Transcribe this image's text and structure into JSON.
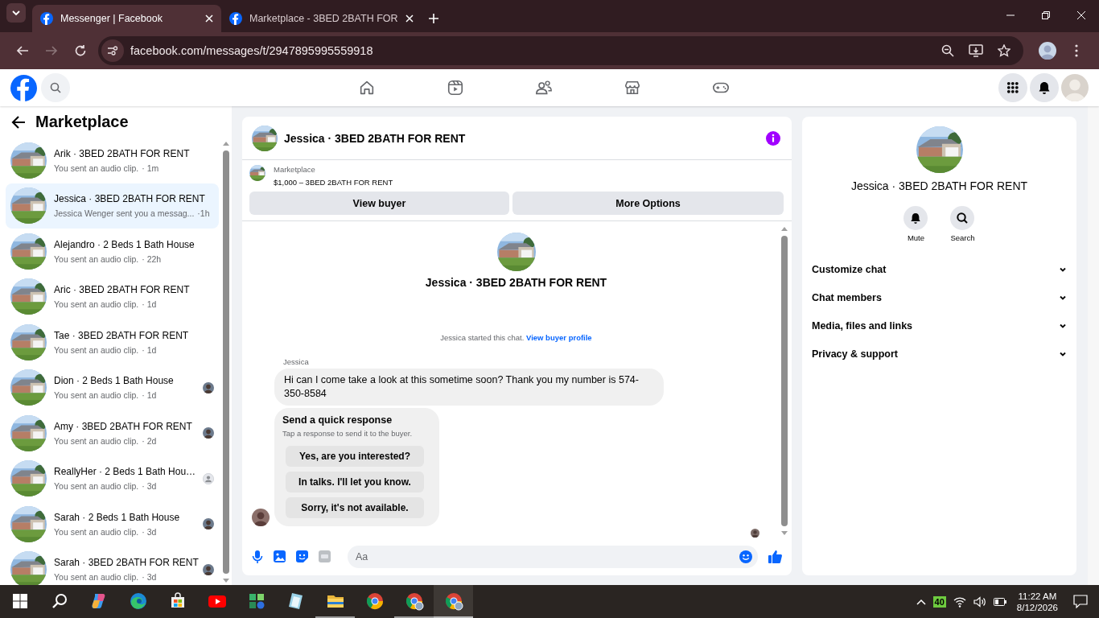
{
  "browser": {
    "tabs": [
      {
        "title": "Messenger | Facebook",
        "selected": true
      },
      {
        "title": "Marketplace - 3BED 2BATH FOR",
        "selected": false
      }
    ],
    "forward_disabled": true,
    "url": "facebook.com/messages/t/2947895995559918"
  },
  "header": {
    "nav_icons": [
      {
        "kind": "home"
      },
      {
        "kind": "video"
      },
      {
        "kind": "friends"
      },
      {
        "kind": "store"
      },
      {
        "kind": "games"
      }
    ]
  },
  "sidebar": {
    "title": "Marketplace",
    "threads": [
      {
        "title": "Arik · 3BED 2BATH FOR RENT",
        "snippet": "You sent an audio clip.",
        "time": "· 1m",
        "selected": false,
        "seen": false
      },
      {
        "title": "Jessica · 3BED 2BATH FOR RENT",
        "snippet": "Jessica Wenger sent you a messag...",
        "time": "·1h",
        "selected": true,
        "seen": false
      },
      {
        "title": "Alejandro · 2 Beds 1 Bath House",
        "snippet": "You sent an audio clip.",
        "time": "· 22h",
        "selected": false,
        "seen": false
      },
      {
        "title": "Aric · 3BED 2BATH FOR RENT",
        "snippet": "You sent an audio clip.",
        "time": "· 1d",
        "selected": false,
        "seen": false
      },
      {
        "title": "Tae · 3BED 2BATH FOR RENT",
        "snippet": "You sent an audio clip.",
        "time": "· 1d",
        "selected": false,
        "seen": false
      },
      {
        "title": "Dion · 2 Beds 1 Bath House",
        "snippet": "You sent an audio clip.",
        "time": "· 1d",
        "selected": false,
        "seen": true,
        "default_avatar": false
      },
      {
        "title": "Amy · 3BED 2BATH FOR RENT",
        "snippet": "You sent an audio clip.",
        "time": "· 2d",
        "selected": false,
        "seen": true,
        "default_avatar": false
      },
      {
        "title": "ReallyHer · 2 Beds 1 Bath Hou…",
        "snippet": "You sent an audio clip.",
        "time": "· 3d",
        "selected": false,
        "seen": true,
        "default_avatar": true
      },
      {
        "title": "Sarah · 2 Beds 1 Bath House",
        "snippet": "You sent an audio clip.",
        "time": "· 3d",
        "selected": false,
        "seen": true,
        "default_avatar": false
      },
      {
        "title": "Sarah · 3BED 2BATH FOR RENT",
        "snippet": "You sent an audio clip.",
        "time": "· 3d",
        "selected": false,
        "seen": true,
        "default_avatar": false
      }
    ]
  },
  "chat": {
    "title": "Jessica · 3BED 2BATH FOR RENT",
    "listing": {
      "source": "Marketplace",
      "summary": "$1,000 – 3BED 2BATH FOR RENT"
    },
    "buttons": [
      "View buyer",
      "More Options"
    ],
    "intro": {
      "title": "Jessica · 3BED 2BATH FOR RENT",
      "notice": "Jessica started this chat.",
      "link": "View buyer profile"
    },
    "sender": "Jessica",
    "message": "Hi can I come take a look at this sometime soon? Thank you my number is 574-350-8584",
    "quick_response": {
      "title": "Send a quick response",
      "subtitle": "Tap a response to send it to the buyer.",
      "options": [
        "Yes, are you interested?",
        "In talks. I'll let you know.",
        "Sorry, it's not available."
      ]
    },
    "composer": {
      "placeholder": "Aa"
    }
  },
  "details": {
    "title": "Jessica · 3BED 2BATH FOR RENT",
    "actions": [
      {
        "label": "Mute",
        "kind": "bell"
      },
      {
        "label": "Search",
        "kind": "search"
      }
    ],
    "sections": [
      {
        "label": "Customize chat",
        "expanded": false
      },
      {
        "label": "Chat members",
        "expanded": false
      },
      {
        "label": "Media, files and links",
        "expanded": false
      },
      {
        "label": "Privacy & support",
        "expanded": false
      }
    ]
  },
  "taskbar": {
    "apps": [
      {
        "kind": "copilot",
        "running": false,
        "selected": false
      },
      {
        "kind": "edge",
        "running": false,
        "selected": false
      },
      {
        "kind": "store",
        "running": false,
        "selected": false
      },
      {
        "kind": "video",
        "running": false,
        "selected": false
      },
      {
        "kind": "leaf",
        "running": false,
        "selected": false
      },
      {
        "kind": "notes",
        "running": false,
        "selected": false
      },
      {
        "kind": "folder",
        "running": true,
        "selected": false
      },
      {
        "kind": "browser",
        "running": false,
        "selected": false
      },
      {
        "kind": "browser-profile",
        "running": true,
        "selected": false
      },
      {
        "kind": "browser-profile",
        "running": true,
        "selected": true
      }
    ],
    "battery_badge": "40",
    "time": "11:22 AM",
    "date": "8/12/2026"
  }
}
